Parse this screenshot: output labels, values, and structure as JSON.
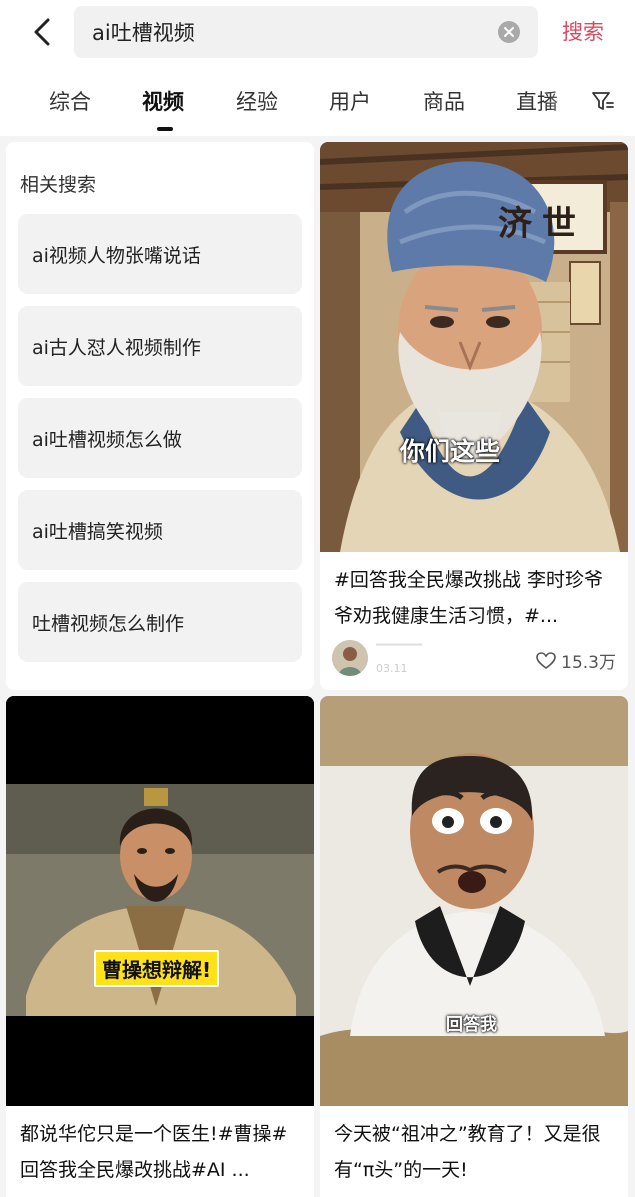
{
  "search": {
    "query": "ai吐槽视频",
    "submit_label": "搜索"
  },
  "tabs": [
    {
      "label": "综合"
    },
    {
      "label": "视频"
    },
    {
      "label": "经验"
    },
    {
      "label": "用户"
    },
    {
      "label": "商品"
    },
    {
      "label": "直播"
    }
  ],
  "active_tab": "视频",
  "related": {
    "title": "相关搜索",
    "items": [
      "ai视频人物张嘴说话",
      "ai古人怼人视频制作",
      "ai吐槽视频怎么做",
      "ai吐槽搞笑视频",
      "吐槽视频怎么制作"
    ]
  },
  "videos": [
    {
      "caption": "你们这些",
      "sign_text": "济世",
      "title": "#回答我全民爆改挑战 李时珍爷爷劝我健康生活习惯，#...",
      "date": "03.11",
      "likes": "15.3万"
    },
    {
      "caption": "曹操想辩解!",
      "title": "都说华佗只是一个医生!#曹操#回答我全民爆改挑战#AI ..."
    },
    {
      "caption": "回答我",
      "title": "今天被“祖冲之”教育了！又是很有“π头”的一天!"
    }
  ],
  "icons": {
    "back": "back-arrow-icon",
    "clear": "clear-icon",
    "filter": "filter-icon",
    "like": "heart-icon"
  },
  "colors": {
    "accent": "#e0485f",
    "caption_yellow": "#ffe11b"
  }
}
